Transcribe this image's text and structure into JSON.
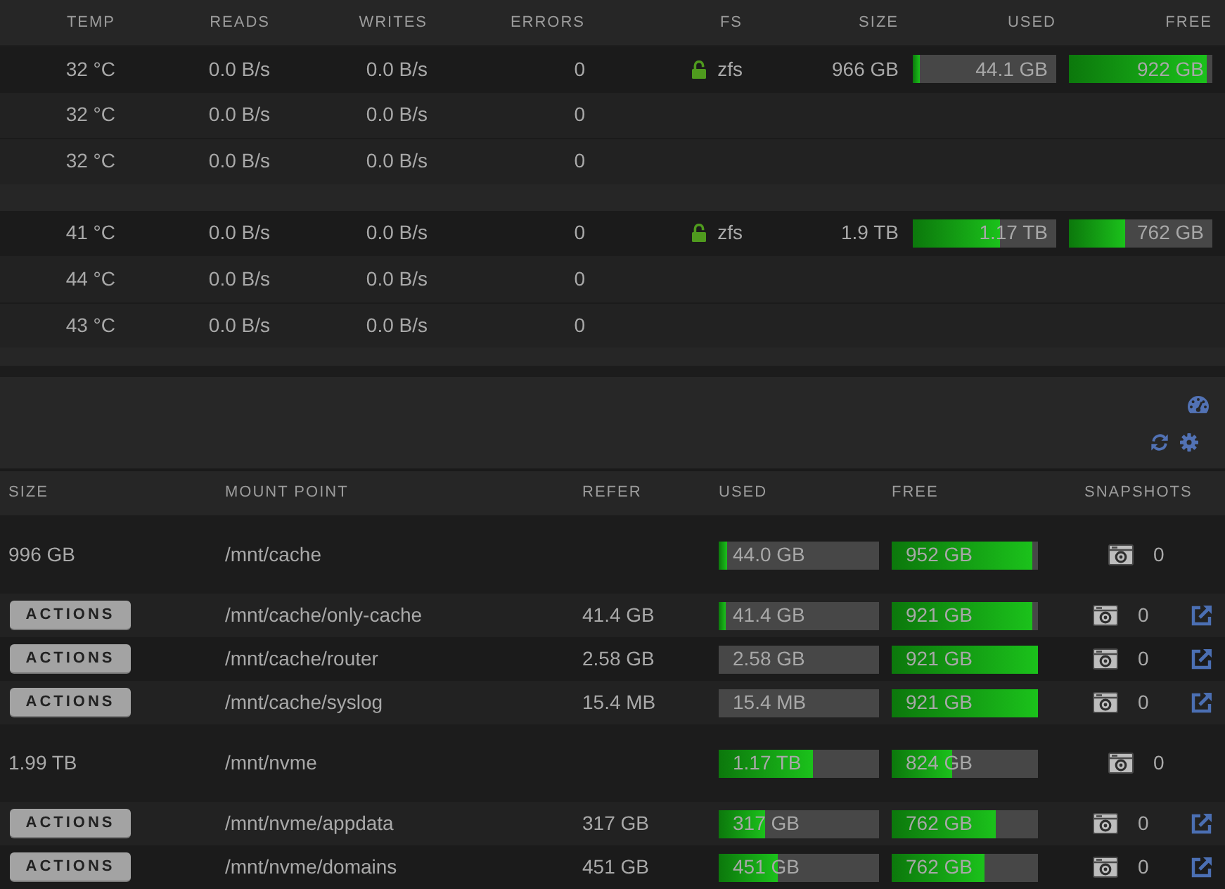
{
  "disk_table": {
    "columns": [
      "TEMP",
      "READS",
      "WRITES",
      "ERRORS",
      "FS",
      "SIZE",
      "USED",
      "FREE"
    ],
    "groups": [
      {
        "rows": [
          {
            "temp": "32 °C",
            "reads": "0.0 B/s",
            "writes": "0.0 B/s",
            "errors": "0",
            "fs": "zfs",
            "size": "966 GB",
            "used": {
              "text": "44.1 GB",
              "level": 0.05
            },
            "free": {
              "text": "922 GB",
              "level": 0.96
            }
          },
          {
            "temp": "32 °C",
            "reads": "0.0 B/s",
            "writes": "0.0 B/s",
            "errors": "0"
          },
          {
            "temp": "32 °C",
            "reads": "0.0 B/s",
            "writes": "0.0 B/s",
            "errors": "0"
          }
        ]
      },
      {
        "rows": [
          {
            "temp": "41 °C",
            "reads": "0.0 B/s",
            "writes": "0.0 B/s",
            "errors": "0",
            "fs": "zfs",
            "size": "1.9 TB",
            "used": {
              "text": "1.17 TB",
              "level": 0.61
            },
            "free": {
              "text": "762 GB",
              "level": 0.39
            }
          },
          {
            "temp": "44 °C",
            "reads": "0.0 B/s",
            "writes": "0.0 B/s",
            "errors": "0"
          },
          {
            "temp": "43 °C",
            "reads": "0.0 B/s",
            "writes": "0.0 B/s",
            "errors": "0"
          }
        ]
      }
    ]
  },
  "dataset_table": {
    "columns": [
      "SIZE",
      "MOUNT POINT",
      "REFER",
      "USED",
      "FREE",
      "SNAPSHOTS"
    ],
    "pools": [
      {
        "size": "996 GB",
        "mount_point": "/mnt/cache",
        "used": {
          "text": "44.0 GB",
          "level": 0.05
        },
        "free": {
          "text": "952 GB",
          "level": 0.96
        },
        "snapshots": "0",
        "children": [
          {
            "action": "ACTIONS",
            "mount_point": "/mnt/cache/only-cache",
            "refer": "41.4 GB",
            "used": {
              "text": "41.4 GB",
              "level": 0.04
            },
            "free": {
              "text": "921 GB",
              "level": 0.96
            },
            "snapshots": "0"
          },
          {
            "action": "ACTIONS",
            "mount_point": "/mnt/cache/router",
            "refer": "2.58 GB",
            "used": {
              "text": "2.58 GB",
              "level": 0
            },
            "free": {
              "text": "921 GB",
              "level": 1
            },
            "snapshots": "0"
          },
          {
            "action": "ACTIONS",
            "mount_point": "/mnt/cache/syslog",
            "refer": "15.4 MB",
            "used": {
              "text": "15.4 MB",
              "level": 0
            },
            "free": {
              "text": "921 GB",
              "level": 1
            },
            "snapshots": "0"
          }
        ]
      },
      {
        "size": "1.99 TB",
        "mount_point": "/mnt/nvme",
        "used": {
          "text": "1.17 TB",
          "level": 0.59
        },
        "free": {
          "text": "824 GB",
          "level": 0.41
        },
        "snapshots": "0",
        "children": [
          {
            "action": "ACTIONS",
            "mount_point": "/mnt/nvme/appdata",
            "refer": "317 GB",
            "used": {
              "text": "317 GB",
              "level": 0.29
            },
            "free": {
              "text": "762 GB",
              "level": 0.71
            },
            "snapshots": "0"
          },
          {
            "action": "ACTIONS",
            "mount_point": "/mnt/nvme/domains",
            "refer": "451 GB",
            "used": {
              "text": "451 GB",
              "level": 0.37
            },
            "free": {
              "text": "762 GB",
              "level": 0.63
            },
            "snapshots": "0"
          }
        ]
      }
    ]
  }
}
